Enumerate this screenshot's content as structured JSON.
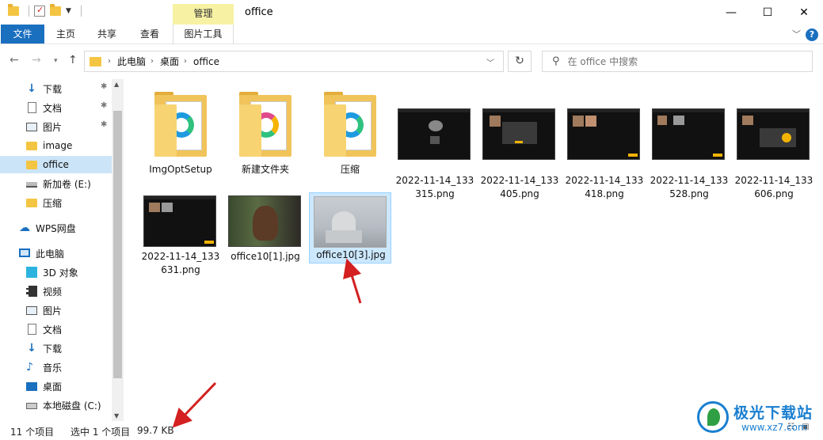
{
  "titlebar": {
    "context_tab": "管理",
    "title": "office",
    "icons": [
      "folder-icon",
      "properties-icon",
      "new-folder-icon",
      "customize-dropdown-icon"
    ],
    "controls": [
      "minimize-icon",
      "maximize-icon",
      "close-icon"
    ]
  },
  "ribbon": {
    "tabs": [
      "文件",
      "主页",
      "共享",
      "查看",
      "图片工具"
    ],
    "help": "?"
  },
  "nav": {
    "breadcrumb": [
      "此电脑",
      "桌面",
      "office"
    ],
    "search_placeholder": "在 office 中搜索"
  },
  "sidebar": {
    "items": [
      {
        "label": "下载",
        "icon": "download-icon",
        "pinned": true
      },
      {
        "label": "文档",
        "icon": "document-icon",
        "pinned": true
      },
      {
        "label": "图片",
        "icon": "picture-icon",
        "pinned": true
      },
      {
        "label": "image",
        "icon": "folder-icon",
        "pinned": false
      },
      {
        "label": "office",
        "icon": "folder-icon",
        "pinned": false,
        "selected": true
      },
      {
        "label": "新加卷 (E:)",
        "icon": "drive-icon",
        "pinned": false
      },
      {
        "label": "压缩",
        "icon": "folder-icon",
        "pinned": false
      },
      {
        "label": "WPS网盘",
        "icon": "cloud-icon",
        "pinned": false
      },
      {
        "label": "此电脑",
        "icon": "computer-icon",
        "pinned": false
      },
      {
        "label": "3D 对象",
        "icon": "cube-icon",
        "pinned": false
      },
      {
        "label": "视频",
        "icon": "video-icon",
        "pinned": false
      },
      {
        "label": "图片",
        "icon": "picture-icon",
        "pinned": false
      },
      {
        "label": "文档",
        "icon": "document-icon",
        "pinned": false
      },
      {
        "label": "下载",
        "icon": "download-icon",
        "pinned": false
      },
      {
        "label": "音乐",
        "icon": "music-icon",
        "pinned": false
      },
      {
        "label": "桌面",
        "icon": "desktop-icon",
        "pinned": false
      },
      {
        "label": "本地磁盘 (C:)",
        "icon": "hard-disk-icon",
        "pinned": false
      }
    ]
  },
  "files": [
    {
      "name": "ImgOptSetup",
      "kind": "folder",
      "logo_color": "#1e9be0"
    },
    {
      "name": "新建文件夹",
      "kind": "folder",
      "logo_color": "#e04a8a"
    },
    {
      "name": "压缩",
      "kind": "folder",
      "logo_color": "#1e9be0"
    },
    {
      "name": "2022-11-14_133\n315.png",
      "kind": "image"
    },
    {
      "name": "2022-11-14_133\n405.png",
      "kind": "image"
    },
    {
      "name": "2022-11-14_133\n418.png",
      "kind": "image"
    },
    {
      "name": "2022-11-14_133\n528.png",
      "kind": "image"
    },
    {
      "name": "2022-11-14_133\n606.png",
      "kind": "image"
    },
    {
      "name": "2022-11-14_133\n631.png",
      "kind": "image"
    },
    {
      "name": "office10[1].jpg",
      "kind": "photo"
    },
    {
      "name": "office10[3].jpg",
      "kind": "photo",
      "selected": true
    }
  ],
  "status": {
    "count": "11 个项目",
    "selection": "选中 1 个项目",
    "size": "99.7 KB"
  },
  "watermark": {
    "title": "极光下载站",
    "url": "www.xz7.com"
  },
  "colors": {
    "accent": "#1a6fbf",
    "selection": "#cce8ff",
    "annotation": "#d42020"
  }
}
